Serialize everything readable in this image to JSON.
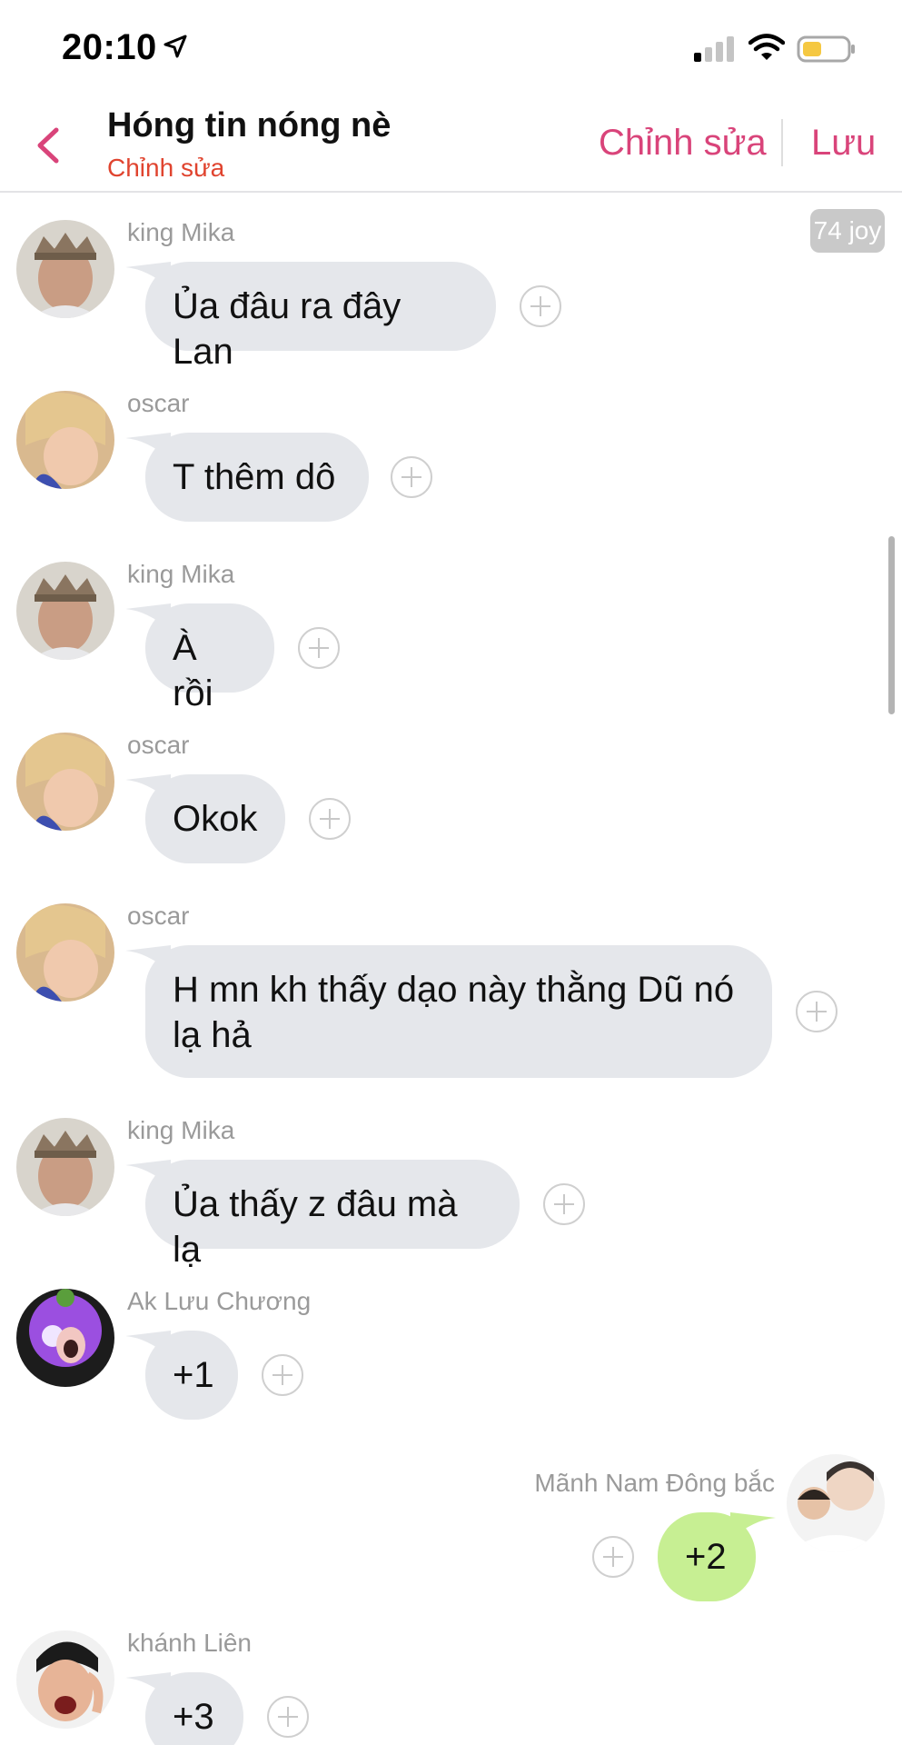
{
  "status_bar": {
    "time": "20:10",
    "icons": [
      "location-arrow-icon",
      "cellular-signal-icon",
      "wifi-icon",
      "battery-icon"
    ],
    "battery_color": "#f5c842"
  },
  "header": {
    "title": "Hóng tin nóng nè",
    "subtitle": "Chỉnh sửa",
    "edit_label": "Chỉnh sửa",
    "save_label": "Lưu",
    "accent_color": "#d9447a"
  },
  "feed": {
    "badge": "74 joy",
    "messages": [
      {
        "sender": "king Mika",
        "text": "Ủa đâu ra đây Lan",
        "direction": "incoming"
      },
      {
        "sender": "oscar",
        "text": "T thêm dô",
        "direction": "incoming"
      },
      {
        "sender": "king Mika",
        "text": "À rồi",
        "direction": "incoming"
      },
      {
        "sender": "oscar",
        "text": "Okok",
        "direction": "incoming"
      },
      {
        "sender": "oscar",
        "text": "H mn kh thấy dạo này thằng Dũ nó lạ hả",
        "direction": "incoming"
      },
      {
        "sender": "king Mika",
        "text": "Ủa thấy z đâu mà lạ",
        "direction": "incoming"
      },
      {
        "sender": "Ak Lưu Chương",
        "text": "+1",
        "direction": "incoming"
      },
      {
        "sender": "Mãnh Nam Đông bắc",
        "text": "+2",
        "direction": "outgoing"
      },
      {
        "sender": "khánh Liên",
        "text": "+3",
        "direction": "incoming"
      }
    ]
  }
}
